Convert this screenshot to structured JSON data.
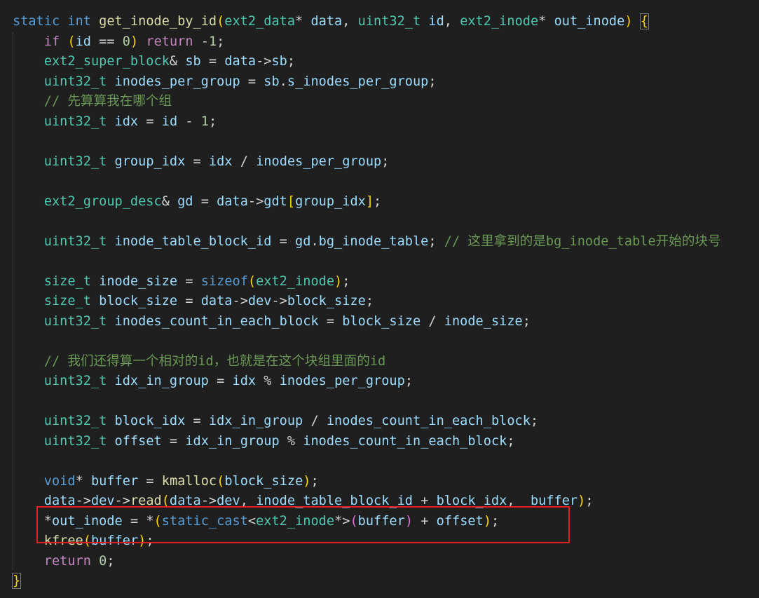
{
  "lines": [
    "static int get_inode_by_id(ext2_data* data, uint32_t id, ext2_inode* out_inode) {",
    "    if (id == 0) return -1;",
    "    ext2_super_block& sb = data->sb;",
    "    uint32_t inodes_per_group = sb.s_inodes_per_group;",
    "    // 先算算我在哪个组",
    "    uint32_t idx = id - 1;",
    "",
    "    uint32_t group_idx = idx / inodes_per_group;",
    "",
    "    ext2_group_desc& gd = data->gdt[group_idx];",
    "",
    "    uint32_t inode_table_block_id = gd.bg_inode_table; // 这里拿到的是bg_inode_table开始的块号",
    "",
    "    size_t inode_size = sizeof(ext2_inode);",
    "    size_t block_size = data->dev->block_size;",
    "    uint32_t inodes_count_in_each_block = block_size / inode_size;",
    "",
    "    // 我们还得算一个相对的id，也就是在这个块组里面的id",
    "    uint32_t idx_in_group = idx % inodes_per_group;",
    "",
    "    uint32_t block_idx = idx_in_group / inodes_count_in_each_block;",
    "    uint32_t offset = idx_in_group % inodes_count_in_each_block;",
    "",
    "    void* buffer = kmalloc(block_size);",
    "    data->dev->read(data->dev, inode_table_block_id + block_idx,  buffer);",
    "    *out_inode = *(static_cast<ext2_inode*>(buffer) + offset);",
    "    kfree(buffer);",
    "    return 0;",
    "}"
  ],
  "colors": {
    "background": "#1f1f1f",
    "keyword": "#569cd6",
    "control": "#c586c0",
    "type": "#4ec9b0",
    "function": "#dcdcaa",
    "variable": "#9cdcfe",
    "number": "#b5cea8",
    "comment": "#6a9955",
    "highlight_box": "#e21e1e"
  }
}
